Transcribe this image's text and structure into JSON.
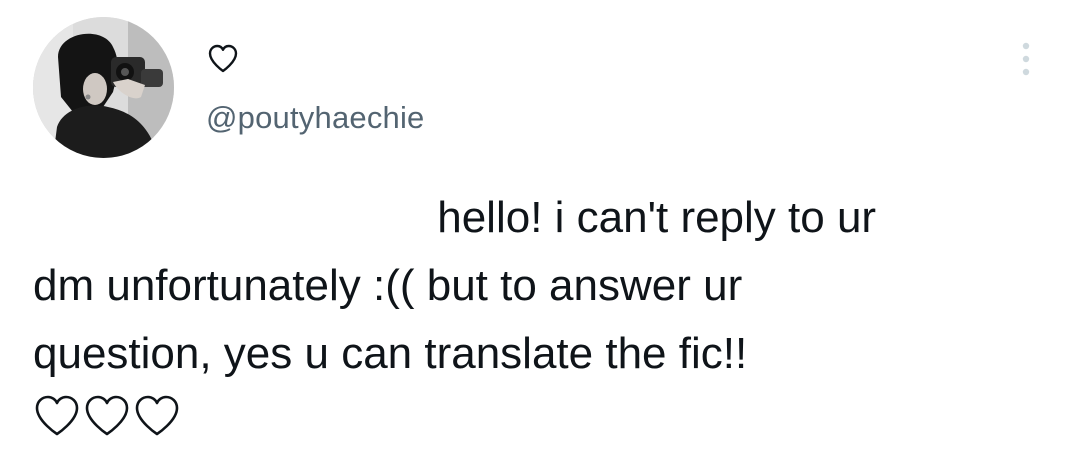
{
  "tweet": {
    "handle": "@poutyhaechie",
    "name_icon": "heart-outline-icon",
    "more_icon": "more-vertical-icon",
    "body": {
      "line1": "hello! i can't reply to ur",
      "line2": "dm unfortunately :(( but to answer ur",
      "line3": "question, yes u can translate the fic!!"
    },
    "trailing_hearts": [
      "heart-outline-icon",
      "heart-outline-icon",
      "heart-outline-icon"
    ]
  },
  "colors": {
    "text": "#0f1419",
    "handle": "#536471",
    "more_dots": "#cfd9de",
    "background": "#ffffff"
  }
}
